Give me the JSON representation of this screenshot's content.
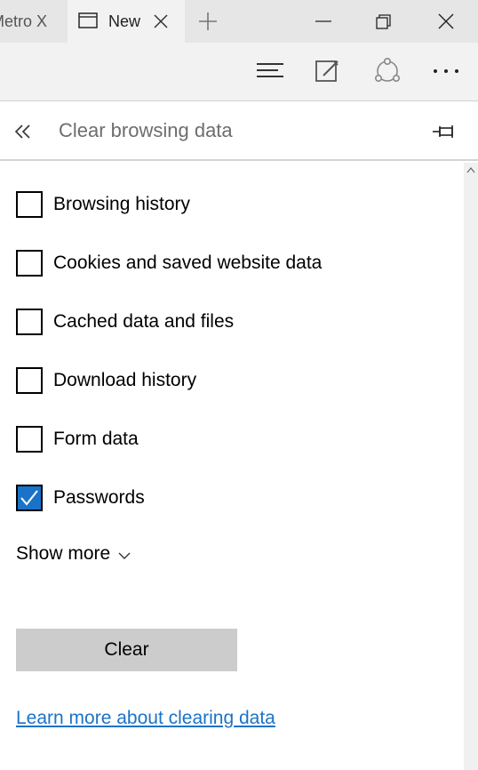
{
  "tabs": [
    {
      "label": "Metro X",
      "active": false
    },
    {
      "label": "New",
      "active": true
    }
  ],
  "panel": {
    "title": "Clear browsing data"
  },
  "options": [
    {
      "label": "Browsing history",
      "checked": false
    },
    {
      "label": "Cookies and saved website data",
      "checked": false
    },
    {
      "label": "Cached data and files",
      "checked": false
    },
    {
      "label": "Download history",
      "checked": false
    },
    {
      "label": "Form data",
      "checked": false
    },
    {
      "label": "Passwords",
      "checked": true
    }
  ],
  "show_more_label": "Show more",
  "clear_button_label": "Clear",
  "learn_more_link": "Learn more about clearing data",
  "icons": {
    "tab_page": "page-icon",
    "tab_close": "close-icon",
    "new_tab": "plus-icon",
    "minimize": "minimize-icon",
    "restore": "restore-icon",
    "close_window": "close-icon",
    "hub": "hub-icon",
    "web_note": "pen-icon",
    "share": "share-icon",
    "more": "more-icon",
    "back": "double-chevron-left-icon",
    "pin": "pin-icon",
    "show_more": "chevron-down-icon",
    "check": "checkmark-icon"
  },
  "colors": {
    "accent": "#1a73c8",
    "titlebar": "#e6e6e6",
    "toolbar": "#f2f2f2",
    "button": "#cccccc"
  }
}
